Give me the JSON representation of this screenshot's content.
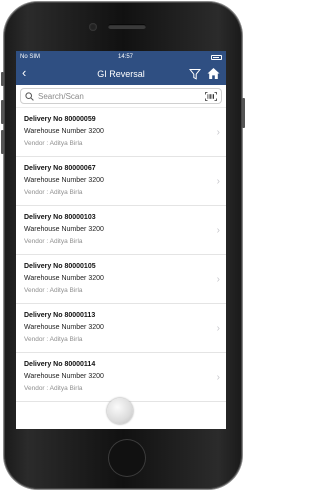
{
  "status_bar": {
    "carrier": "No SIM",
    "time": "14:57"
  },
  "nav": {
    "title": "GI Reversal",
    "back_glyph": "‹"
  },
  "search": {
    "placeholder": "Search/Scan"
  },
  "deliveries": [
    {
      "title": "Delivery No 80000059",
      "warehouse": "Warehouse Number 3200",
      "vendor": "Vendor : Aditya Birla"
    },
    {
      "title": "Delivery No 80000067",
      "warehouse": "Warehouse Number 3200",
      "vendor": "Vendor : Aditya Birla"
    },
    {
      "title": "Delivery No 80000103",
      "warehouse": "Warehouse Number 3200",
      "vendor": "Vendor : Aditya Birla"
    },
    {
      "title": "Delivery No 80000105",
      "warehouse": "Warehouse Number 3200",
      "vendor": "Vendor : Aditya Birla"
    },
    {
      "title": "Delivery No 80000113",
      "warehouse": "Warehouse Number 3200",
      "vendor": "Vendor : Aditya Birla"
    },
    {
      "title": "Delivery No 80000114",
      "warehouse": "Warehouse Number 3200",
      "vendor": "Vendor : Aditya Birla"
    }
  ],
  "chevron_glyph": "›",
  "colors": {
    "nav_bar": "#2f4f82",
    "background": "#ffffff",
    "secondary_text": "#8f8f8f"
  },
  "icons": [
    "back-icon",
    "filter-icon",
    "home-icon",
    "search-icon",
    "barcode-icon",
    "chevron-right-icon",
    "battery-icon"
  ]
}
